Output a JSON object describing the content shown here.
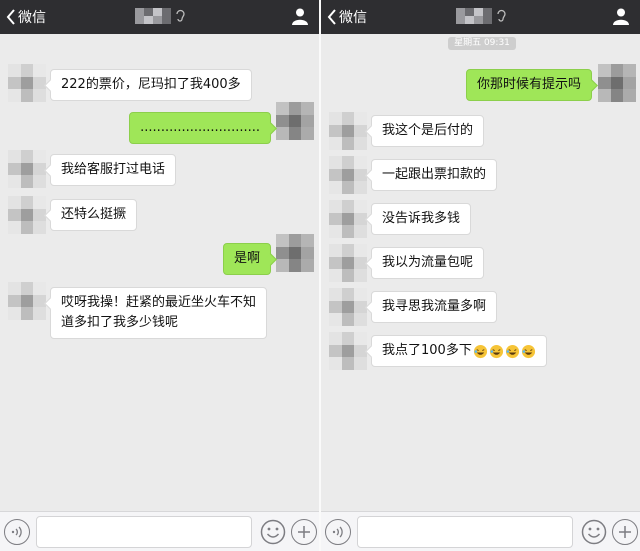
{
  "left": {
    "back_label": "微信",
    "messages": [
      {
        "side": "recv",
        "text": "222的票价，尼玛扣了我400多"
      },
      {
        "side": "sent",
        "text": "............................."
      },
      {
        "side": "recv",
        "text": "我给客服打过电话"
      },
      {
        "side": "recv",
        "text": "还特么挺撅"
      },
      {
        "side": "sent",
        "text": "是啊"
      },
      {
        "side": "recv",
        "text": "哎呀我操！赶紧的最近坐火车不知"
      },
      {
        "side": "recv",
        "text": "道多扣了我多少钱呢"
      }
    ]
  },
  "right": {
    "back_label": "微信",
    "timestamp": "星期五 09:31",
    "messages": [
      {
        "side": "sent",
        "text": "你那时候有提示吗"
      },
      {
        "side": "recv",
        "text": "我这个是后付的"
      },
      {
        "side": "recv",
        "text": "一起跟出票扣款的"
      },
      {
        "side": "recv",
        "text": "没告诉我多钱"
      },
      {
        "side": "recv",
        "text": "我以为流量包呢"
      },
      {
        "side": "recv",
        "text": "我寻思我流量多啊"
      },
      {
        "side": "recv",
        "text": "我点了100多下"
      }
    ]
  },
  "colors": {
    "nav_bg": "#2e2e31",
    "chat_bg": "#ebebeb",
    "sent_bubble": "#9fe658",
    "recv_bubble": "#ffffff"
  },
  "icons": [
    "back-chevron-icon",
    "ear-icon",
    "person-icon",
    "voice-icon",
    "emoji-icon",
    "plus-icon",
    "laughing-emoji-icon"
  ]
}
